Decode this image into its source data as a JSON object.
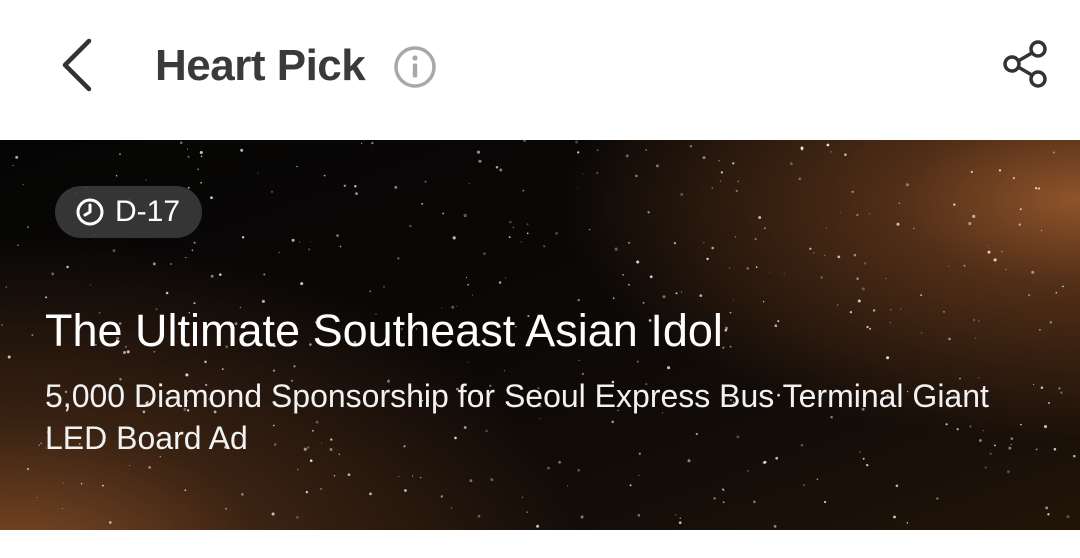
{
  "header": {
    "title": "Heart Pick",
    "icons": {
      "back": "chevron-left-icon",
      "info": "info-circle-icon",
      "share": "share-icon"
    }
  },
  "banner": {
    "dday": "D-17",
    "title": "The Ultimate Southeast Asian Idol",
    "subtitle": "5,000 Diamond Sponsorship for Seoul Express Bus Terminal Giant LED Board Ad",
    "colors": {
      "accent_glow": "#96582d",
      "background_dark": "#050505",
      "badge_bg": "#3a3a3a"
    }
  }
}
